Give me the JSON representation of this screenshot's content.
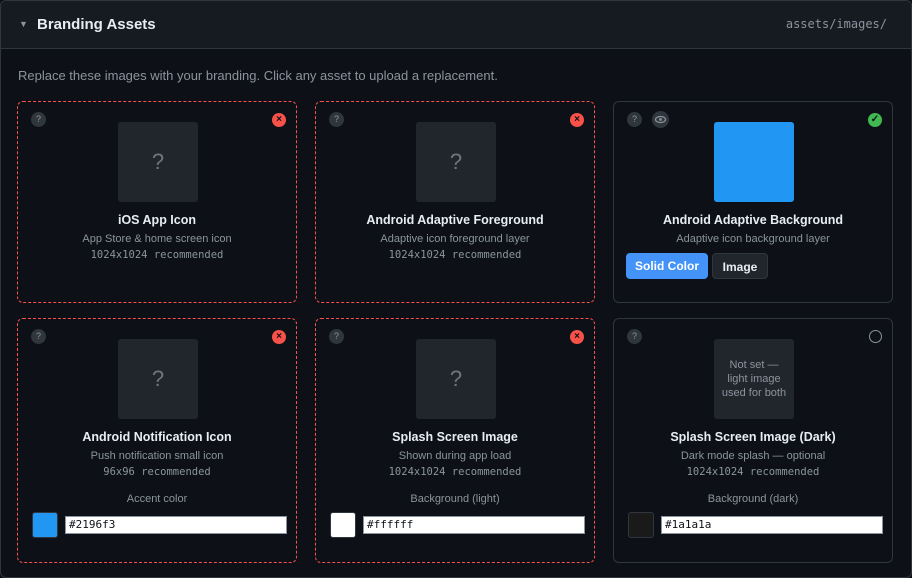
{
  "header": {
    "title": "Branding Assets",
    "path": "assets/images/"
  },
  "description": "Replace these images with your branding. Click any asset to upload a replacement.",
  "assets": [
    {
      "name": "iOS App Icon",
      "subtitle": "App Store & home screen icon",
      "recommended": "1024x1024 recommended",
      "placeholder": "?",
      "status": "missing"
    },
    {
      "name": "Android Adaptive Foreground",
      "subtitle": "Adaptive icon foreground layer",
      "recommended": "1024x1024 recommended",
      "placeholder": "?",
      "status": "missing"
    },
    {
      "name": "Android Adaptive Background",
      "subtitle": "Adaptive icon background layer",
      "status": "set",
      "color": "#2196f3",
      "toggle": {
        "solid_label": "Solid Color",
        "image_label": "Image"
      }
    },
    {
      "name": "Android Notification Icon",
      "subtitle": "Push notification small icon",
      "recommended": "96x96 recommended",
      "placeholder": "?",
      "status": "missing",
      "color_label": "Accent color",
      "color": "#2196f3"
    },
    {
      "name": "Splash Screen Image",
      "subtitle": "Shown during app load",
      "recommended": "1024x1024 recommended",
      "placeholder": "?",
      "status": "missing",
      "color_label": "Background (light)",
      "color": "#ffffff"
    },
    {
      "name": "Splash Screen Image (Dark)",
      "subtitle": "Dark mode splash — optional",
      "recommended": "1024x1024 recommended",
      "placeholder": "Not set — light image used for both",
      "status": "optional",
      "color_label": "Background (dark)",
      "color": "#1a1a1a"
    }
  ],
  "icons": {
    "help": "?",
    "missing": "×",
    "set": "✓"
  }
}
